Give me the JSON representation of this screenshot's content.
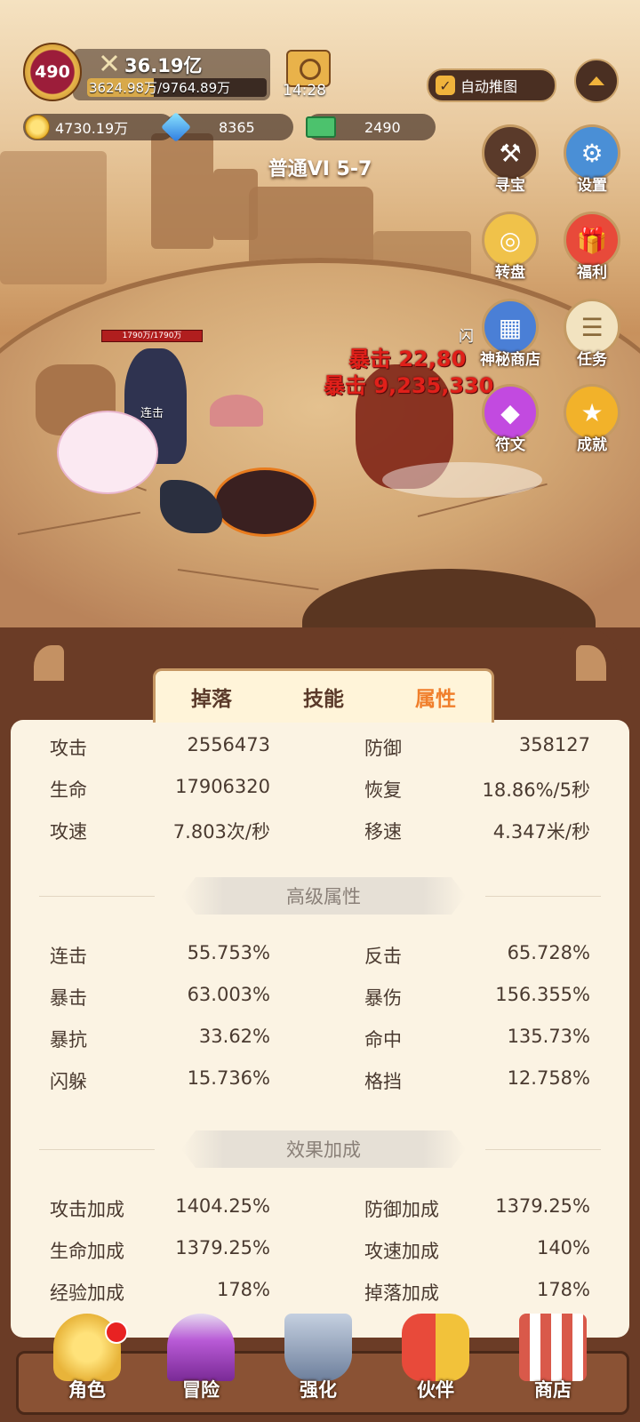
{
  "hud": {
    "level": "490",
    "power": "36.19亿",
    "exp_text": "3624.98万/9764.89万",
    "exp_progress": 0.371,
    "timer": "14:28",
    "auto_push_label": "自动推图"
  },
  "resources": {
    "gold": "4730.19万",
    "diamond": "8365",
    "cash": "2490"
  },
  "stage": "普通VI 5-7",
  "side_buttons": [
    {
      "label": "寻宝",
      "icon": "hammer-icon"
    },
    {
      "label": "设置",
      "icon": "gear-icon"
    },
    {
      "label": "转盘",
      "icon": "wheel-icon"
    },
    {
      "label": "福利",
      "icon": "gift-icon"
    },
    {
      "label": "神秘商店",
      "icon": "shop-icon"
    },
    {
      "label": "任务",
      "icon": "scroll-icon"
    },
    {
      "label": "符文",
      "icon": "rune-icon"
    },
    {
      "label": "成就",
      "icon": "star-icon"
    }
  ],
  "battle": {
    "hero_hp": "1790万/1790万",
    "combo_label": "连击",
    "dodge_label": "闪",
    "crit1": "暴击 22,80",
    "crit2": "暴击 9,235,330"
  },
  "tabs": [
    "掉落",
    "技能",
    "属性"
  ],
  "active_tab": "属性",
  "basic_stats": [
    {
      "l_label": "攻击",
      "l_value": "2556473",
      "r_label": "防御",
      "r_value": "358127"
    },
    {
      "l_label": "生命",
      "l_value": "17906320",
      "r_label": "恢复",
      "r_value": "18.86%/5秒"
    },
    {
      "l_label": "攻速",
      "l_value": "7.803次/秒",
      "r_label": "移速",
      "r_value": "4.347米/秒"
    }
  ],
  "advanced_title": "高级属性",
  "advanced_stats": [
    {
      "l_label": "连击",
      "l_value": "55.753%",
      "r_label": "反击",
      "r_value": "65.728%"
    },
    {
      "l_label": "暴击",
      "l_value": "63.003%",
      "r_label": "暴伤",
      "r_value": "156.355%"
    },
    {
      "l_label": "暴抗",
      "l_value": "33.62%",
      "r_label": "命中",
      "r_value": "135.73%"
    },
    {
      "l_label": "闪躲",
      "l_value": "15.736%",
      "r_label": "格挡",
      "r_value": "12.758%"
    }
  ],
  "bonus_title": "效果加成",
  "bonus_stats": [
    {
      "l_label": "攻击加成",
      "l_value": "1404.25%",
      "r_label": "防御加成",
      "r_value": "1379.25%"
    },
    {
      "l_label": "生命加成",
      "l_value": "1379.25%",
      "r_label": "攻速加成",
      "r_value": "140%"
    },
    {
      "l_label": "经验加成",
      "l_value": "178%",
      "r_label": "掉落加成",
      "r_value": "178%"
    }
  ],
  "nav": [
    {
      "label": "角色",
      "icon": "role-icon",
      "color": "#e8b43a"
    },
    {
      "label": "冒险",
      "icon": "adventure-icon",
      "color": "#b85ad6"
    },
    {
      "label": "强化",
      "icon": "anvil-icon",
      "color": "#8a9bb5"
    },
    {
      "label": "伙伴",
      "icon": "partner-icon",
      "color": "#e84a3a"
    },
    {
      "label": "商店",
      "icon": "store-icon",
      "color": "#d9594a"
    }
  ]
}
